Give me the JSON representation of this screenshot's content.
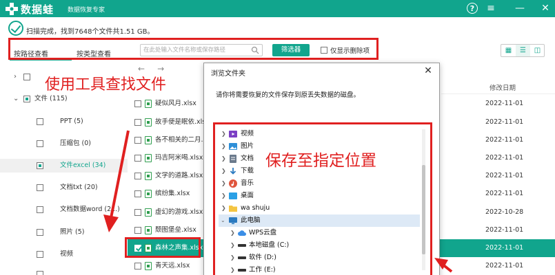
{
  "app": {
    "brand": "数据蛙",
    "tagline": "数据恢复专家",
    "accent": "#11a58d",
    "help_icon": "help-icon",
    "menu_icon": "menu-icon",
    "minimize_icon": "minimize-icon",
    "close_icon": "close-icon"
  },
  "status": {
    "text": "扫描完成，找到7648个文件共1.51 GB。"
  },
  "toolbar": {
    "tab_path": "按路径查看",
    "tab_type": "按类型查看",
    "search_placeholder": "在此处输入文件名称或保存路径",
    "filter_label": "筛选器",
    "deleted_only_label": "仅显示删除项"
  },
  "sidebar": {
    "items": [
      {
        "label": ""
      },
      {
        "label": "文件 (115)"
      },
      {
        "label": "PPT (5)"
      },
      {
        "label": "压缩包 (0)"
      },
      {
        "label": "文件excel (34)"
      },
      {
        "label": "文档txt (20)"
      },
      {
        "label": "文档数据word (2...)"
      },
      {
        "label": "照片 (5)"
      },
      {
        "label": "视频"
      },
      {
        "label": ""
      }
    ]
  },
  "list": {
    "date_header": "修改日期",
    "rows": [
      {
        "name": "疑似风月.xlsx",
        "date": "2022-11-01"
      },
      {
        "name": "故手便是眠依.xlsx",
        "date": "2022-11-01"
      },
      {
        "name": "各不相关的二月.xlsx",
        "date": "2022-11-01"
      },
      {
        "name": "玛吉阿米喝.xlsx",
        "date": "2022-11-01"
      },
      {
        "name": "文学的道路.xlsx",
        "date": "2022-11-01"
      },
      {
        "name": "缤纷集.xlsx",
        "date": "2022-11-01"
      },
      {
        "name": "虚幻的游戏.xlsx",
        "date": "2022-10-28"
      },
      {
        "name": "颓图堡垒.xlsx",
        "date": "2022-11-01"
      },
      {
        "name": "森林之声集.xlsx",
        "date": "2022-11-01"
      },
      {
        "name": "青天远.xlsx",
        "date": "2022-11-01"
      }
    ]
  },
  "dialog": {
    "title": "浏览文件夹",
    "message": "请你将需要恢复的文件保存到原丢失数据的磁盘。",
    "folders": [
      {
        "label": "视频",
        "icon": "video-folder-icon"
      },
      {
        "label": "图片",
        "icon": "picture-folder-icon"
      },
      {
        "label": "文档",
        "icon": "document-folder-icon"
      },
      {
        "label": "下载",
        "icon": "download-icon"
      },
      {
        "label": "音乐",
        "icon": "music-icon"
      },
      {
        "label": "桌面",
        "icon": "desktop-folder-icon"
      },
      {
        "label": "wa shuju",
        "icon": "folder-icon"
      },
      {
        "label": "此电脑",
        "icon": "computer-icon"
      },
      {
        "label": "WPS云盘",
        "icon": "cloud-icon"
      },
      {
        "label": "本地磁盘 (C:)",
        "icon": "drive-icon"
      },
      {
        "label": "软件 (D:)",
        "icon": "drive-icon"
      },
      {
        "label": "工作 (E:)",
        "icon": "drive-icon"
      }
    ]
  },
  "annotations": {
    "use_tool": "使用工具查找文件",
    "save_location": "保存至指定位置",
    "color": "#e02020"
  }
}
